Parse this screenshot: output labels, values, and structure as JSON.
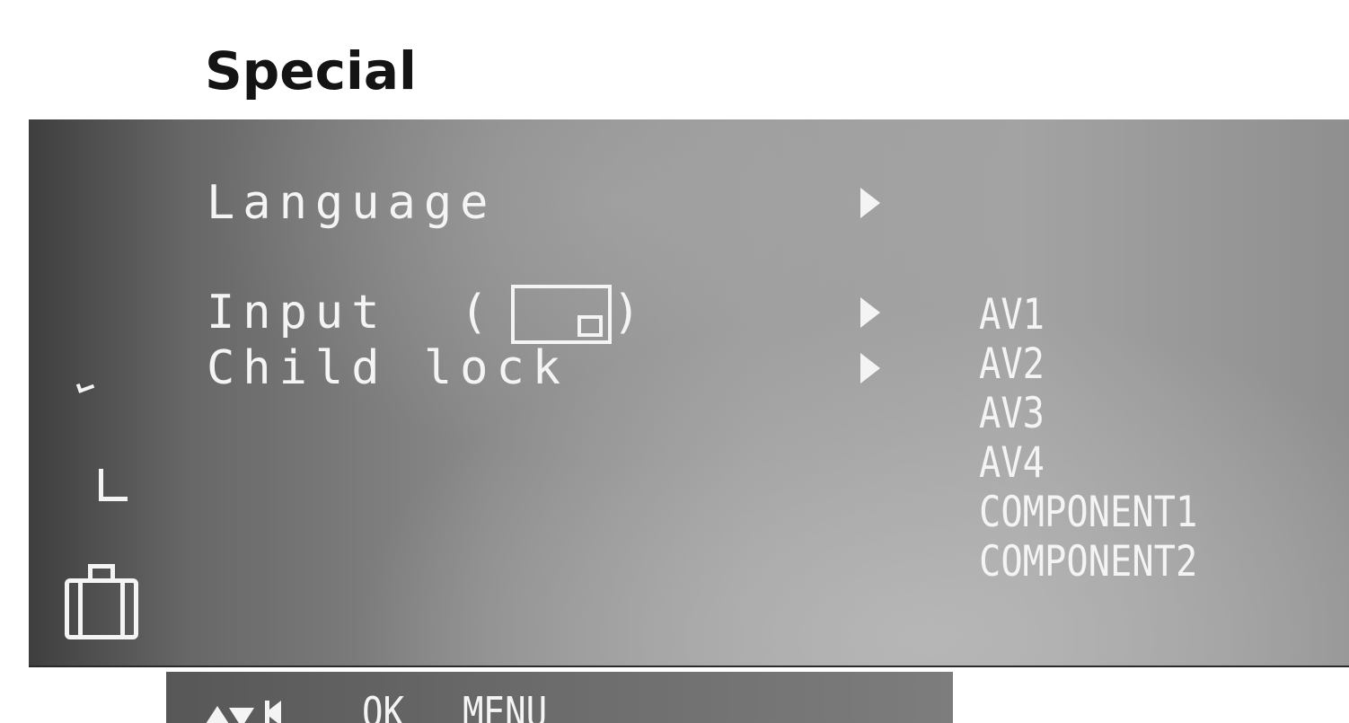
{
  "page": {
    "title": "Special"
  },
  "menu": {
    "items": [
      {
        "label": "Language",
        "icon": "right-arrow-icon"
      },
      {
        "label": "Input  (",
        "suffix": ")",
        "icon": "right-arrow-icon",
        "inline_icon": "pip-icon"
      },
      {
        "label": "Child lock",
        "icon": "right-arrow-icon"
      }
    ],
    "input_options": [
      "AV1",
      "AV2",
      "AV3",
      "AV4",
      "COMPONENT1",
      "COMPONENT2"
    ]
  },
  "sidebar": {
    "icons": [
      "check-mark-icon",
      "corner-icon",
      "bag-icon"
    ]
  },
  "footer": {
    "ok_label": "OK",
    "menu_label": "MENU",
    "icons": [
      "up-down-icon",
      "left-arrow-icon"
    ]
  },
  "colors": {
    "text": "#f4f4f4",
    "title": "#141414",
    "panel_dark": "#3e3e3e",
    "panel_light": "#a3a3a3"
  }
}
